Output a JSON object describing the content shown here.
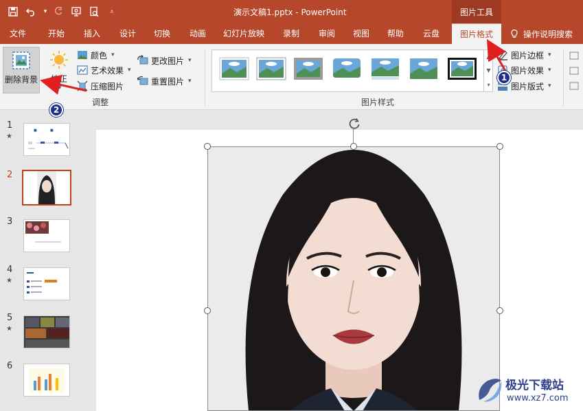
{
  "titlebar": {
    "doc_title": "演示文稿1.pptx  -  PowerPoint",
    "context_tools": "图片工具"
  },
  "tabs": [
    {
      "label": "文件"
    },
    {
      "label": "开始"
    },
    {
      "label": "插入"
    },
    {
      "label": "设计"
    },
    {
      "label": "切换"
    },
    {
      "label": "动画"
    },
    {
      "label": "幻灯片放映"
    },
    {
      "label": "录制"
    },
    {
      "label": "审阅"
    },
    {
      "label": "视图"
    },
    {
      "label": "帮助"
    },
    {
      "label": "云盘"
    },
    {
      "label": "图片格式",
      "active": true
    }
  ],
  "search": {
    "label": "操作说明搜索"
  },
  "ribbon": {
    "remove_bg": "删除背景",
    "correct": "校正",
    "color": "颜色",
    "artistic": "艺术效果",
    "compress": "压缩图片",
    "change_pic": "更改图片",
    "reset_pic": "重置图片",
    "adjust_group": "调整",
    "styles_group": "图片样式",
    "border": "图片边框",
    "effects": "图片效果",
    "layout": "图片版式"
  },
  "slides": [
    {
      "num": "1",
      "star": true
    },
    {
      "num": "2",
      "star": false,
      "active": true
    },
    {
      "num": "3",
      "star": false
    },
    {
      "num": "4",
      "star": true
    },
    {
      "num": "5",
      "star": true
    },
    {
      "num": "6",
      "star": false
    }
  ],
  "badges": {
    "one": "1",
    "two": "2"
  },
  "watermark": {
    "name": "极光下载站",
    "url": "www.xz7.com"
  },
  "colors": {
    "accent": "#b7472a",
    "badge": "#1e2f8a",
    "arrow": "#e02020"
  }
}
